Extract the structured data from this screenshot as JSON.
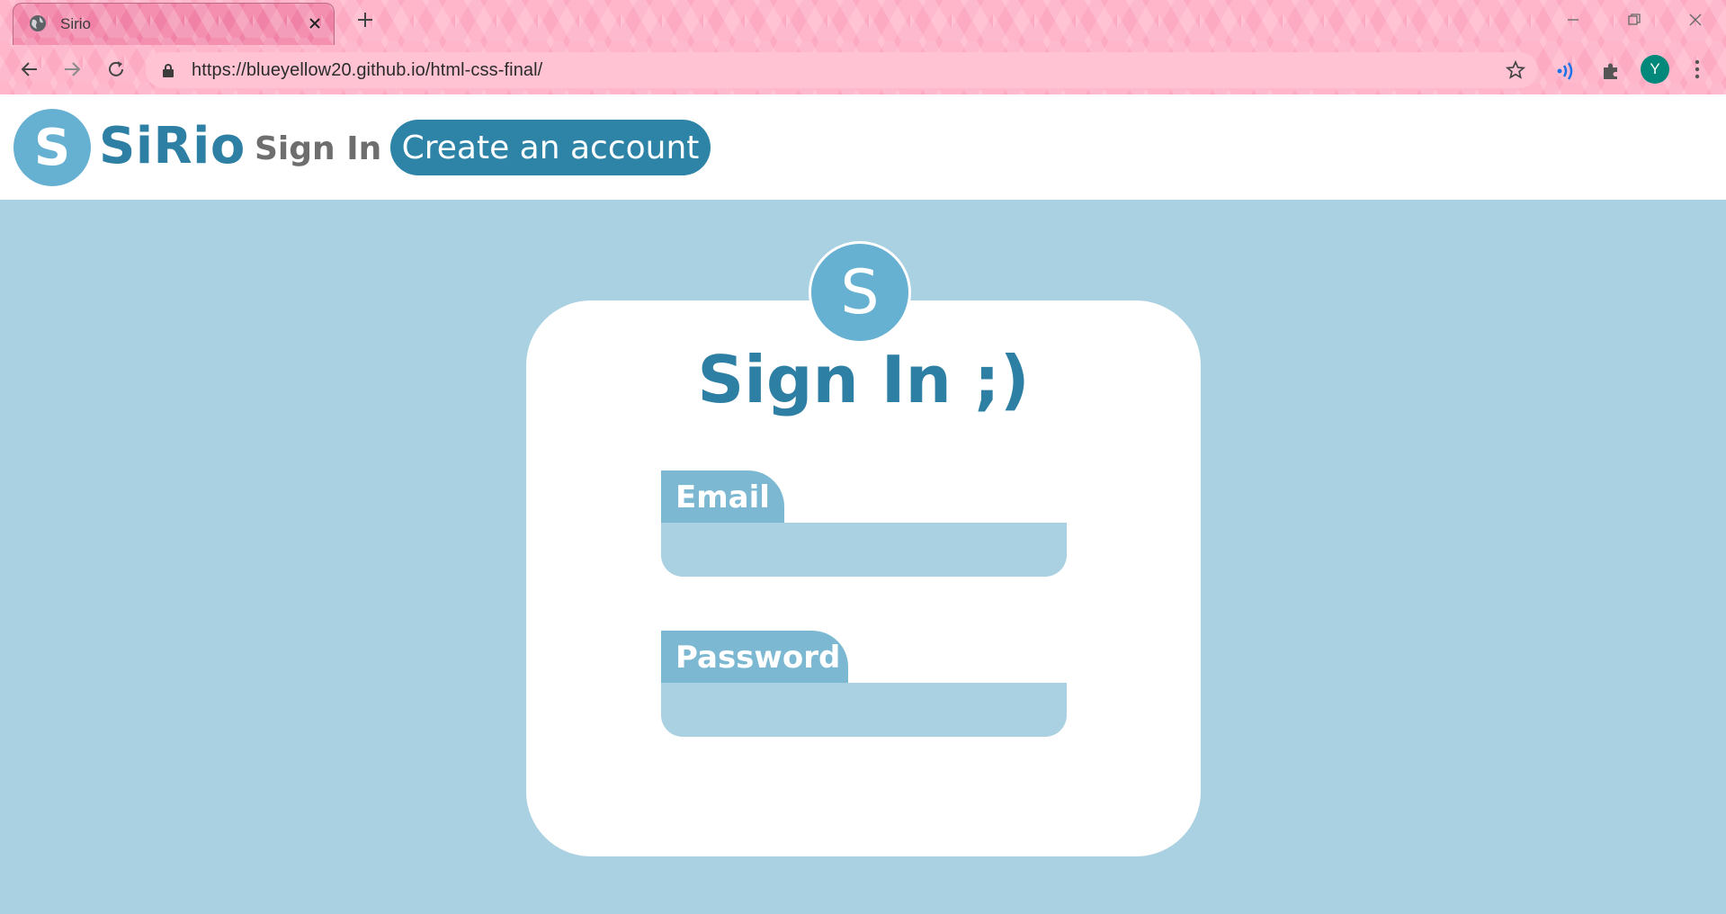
{
  "browser": {
    "tab_title": "Sirio",
    "url": "https://blueyellow20.github.io/html-css-final/",
    "profile_initial": "Y",
    "theme_color": "#ffb6cb"
  },
  "header": {
    "logo_letter": "S",
    "brand": "SiRio",
    "nav_signin": "Sign In",
    "nav_create": "Create an account"
  },
  "card": {
    "avatar_letter": "S",
    "title": "Sign In ;)",
    "email_label": "Email",
    "password_label": "Password"
  },
  "colors": {
    "page_background": "#a9d1e1",
    "brand_blue": "#2e7fa4",
    "accent_blue": "#66b0d2",
    "button_blue": "#2e84a6"
  }
}
